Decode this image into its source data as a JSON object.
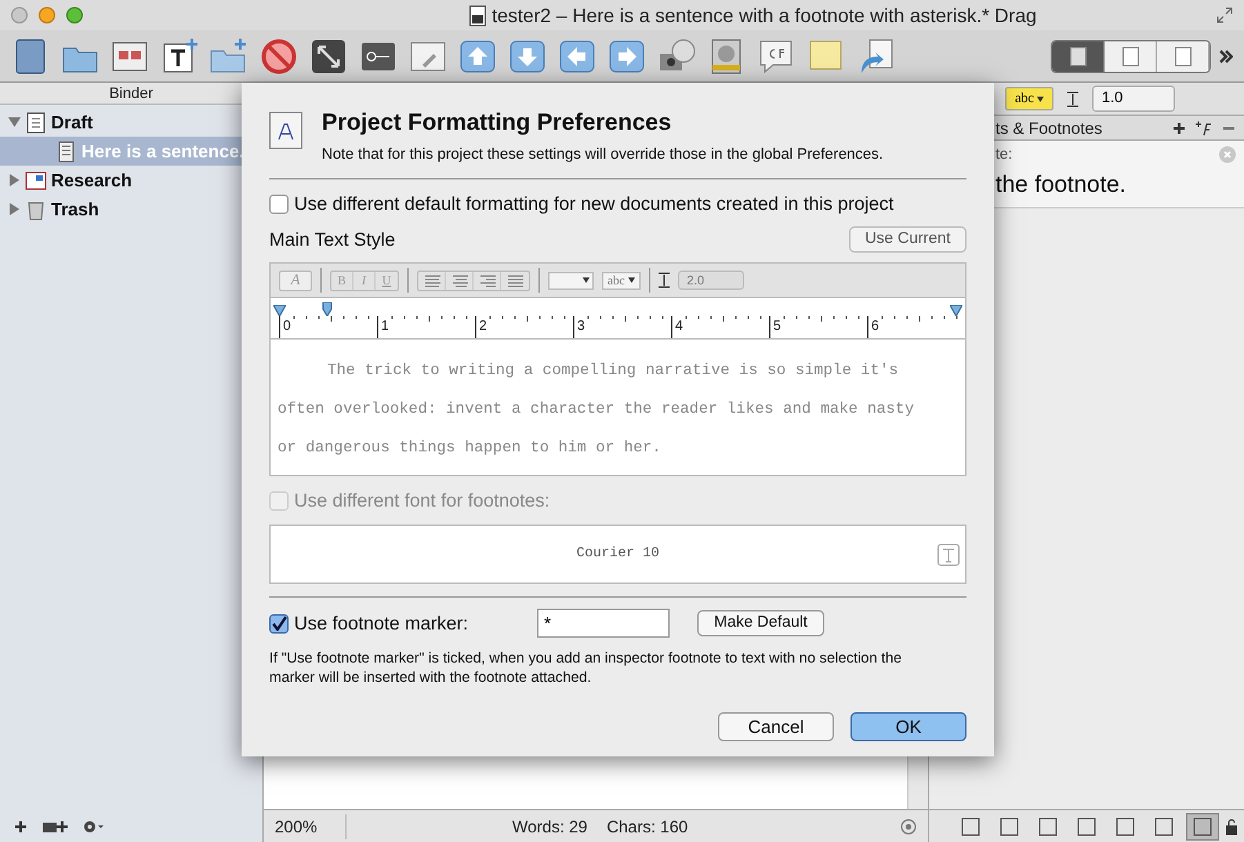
{
  "window": {
    "title": "tester2 – Here is a sentence with a footnote with asterisk.* Drag"
  },
  "toolbar": {
    "view_modes": [
      {
        "selected": true
      },
      {
        "selected": false
      },
      {
        "selected": false
      }
    ]
  },
  "binder": {
    "header": "Binder",
    "items": [
      {
        "label": "Draft",
        "kind": "draft",
        "expanded": true,
        "selected": false,
        "children": [
          {
            "label": "Here is a sentence.",
            "kind": "document",
            "selected": true
          }
        ]
      },
      {
        "label": "Research",
        "kind": "research",
        "expanded": false,
        "selected": false
      },
      {
        "label": "Trash",
        "kind": "trash",
        "expanded": false,
        "selected": false
      }
    ]
  },
  "format_bar": {
    "highlight": "abc",
    "line_spacing": "1.0"
  },
  "inspector": {
    "header": "ts & Footnotes",
    "label": "te:",
    "footnote": "the footnote.",
    "tabs": [
      {
        "selected": false
      },
      {
        "selected": false
      },
      {
        "selected": false
      },
      {
        "selected": false
      },
      {
        "selected": false
      },
      {
        "selected": false
      },
      {
        "selected": true
      }
    ]
  },
  "status_bar": {
    "zoom": "200%",
    "words": "Words: 29",
    "chars": "Chars: 160"
  },
  "sheet": {
    "title": "Project Formatting Preferences",
    "note": "Note that for this project these settings will override those in the global Preferences.",
    "default_formatting": {
      "label": "Use different default formatting for new documents created in this project",
      "checked": false
    },
    "main_text_style": {
      "label": "Main Text Style",
      "use_current": "Use Current",
      "font_button": "A",
      "bold": "B",
      "italic": "I",
      "underline": "U",
      "style_menu": "abc",
      "line_spacing": "2.0",
      "ruler": [
        "0",
        "1",
        "2",
        "3",
        "4",
        "5",
        "6"
      ],
      "sample": "The trick to writing a compelling narrative is so simple it's often overlooked: invent a character the reader likes and make nasty or dangerous things happen to him or her."
    },
    "footnote_font": {
      "label": "Use different font for footnotes:",
      "checked": false,
      "disabled": true,
      "font": "Courier 10"
    },
    "footnote_marker": {
      "label": "Use footnote marker:",
      "checked": true,
      "value": "*",
      "make_default": "Make Default"
    },
    "help": "If \"Use footnote marker\" is ticked, when you add an inspector footnote to text with no selection the marker will be inserted with the footnote attached.",
    "buttons": [
      {
        "label": "Cancel",
        "kind": "cancel"
      },
      {
        "label": "OK",
        "kind": "default"
      }
    ]
  }
}
